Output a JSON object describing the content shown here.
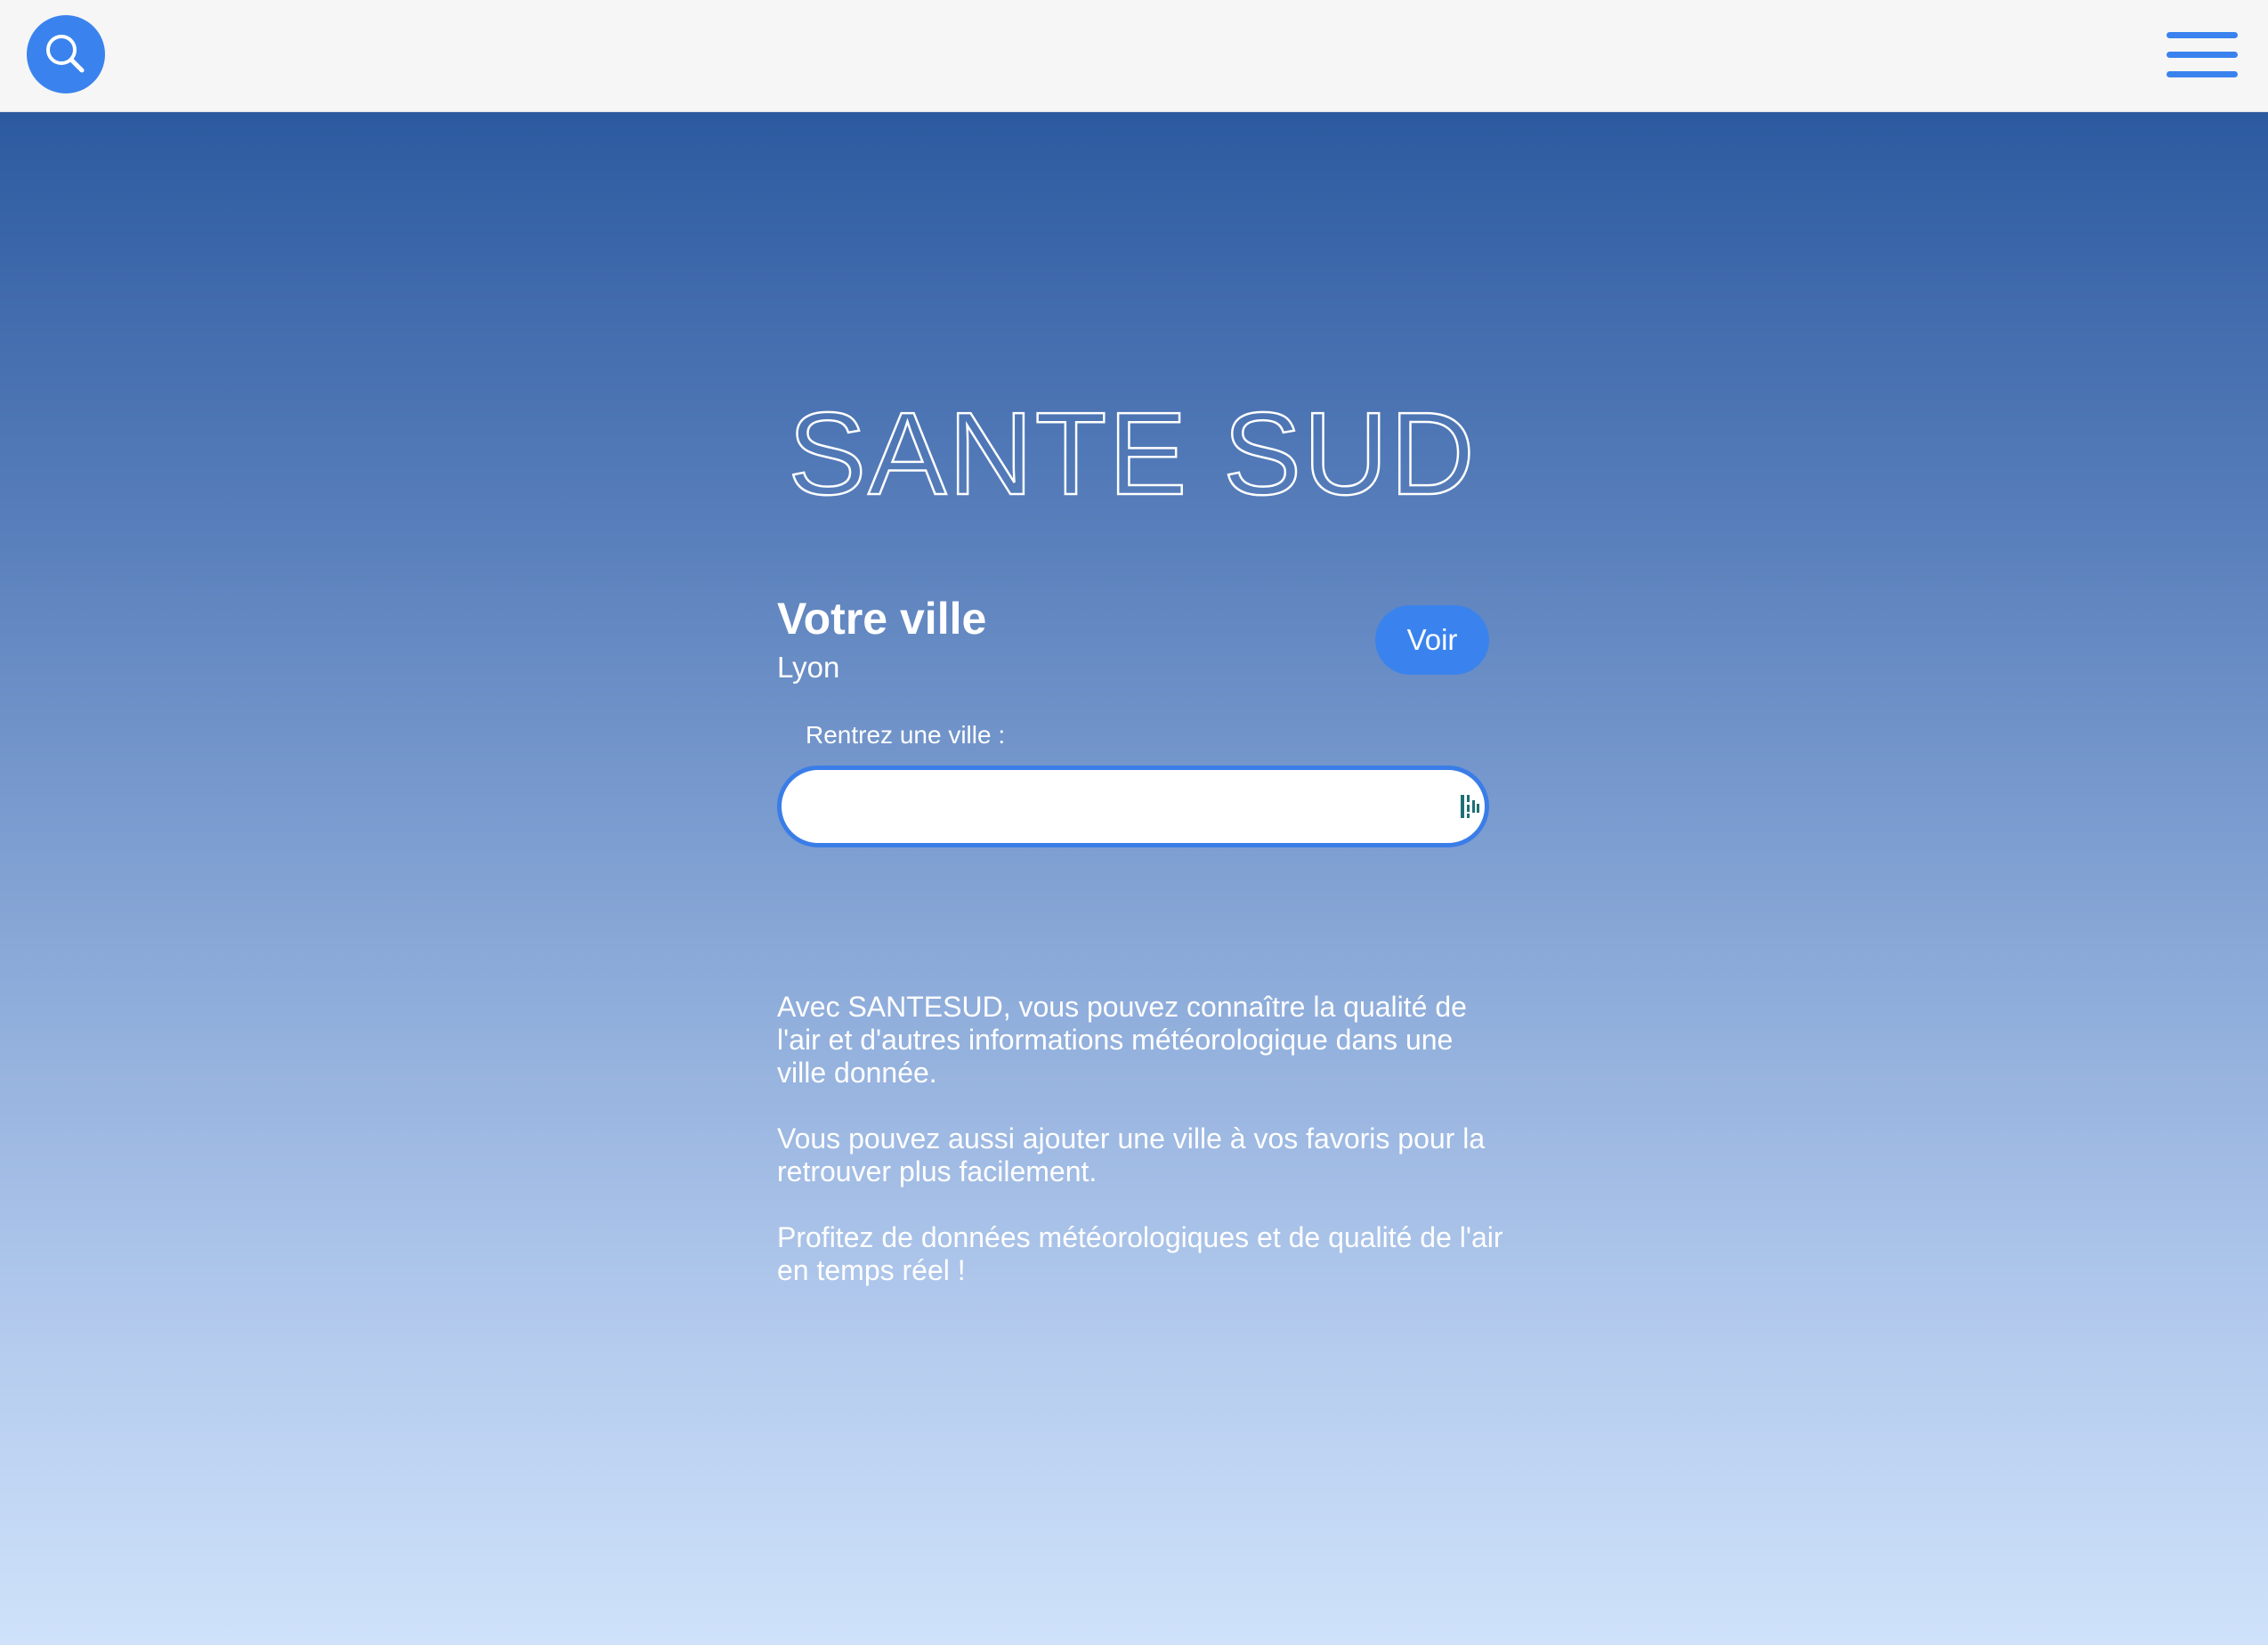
{
  "header": {
    "search_icon": "search-icon",
    "menu_icon": "hamburger-menu-icon"
  },
  "brand": {
    "title": "SANTE SUD"
  },
  "city_card": {
    "title": "Votre ville",
    "city": "Lyon",
    "button_label": "Voir"
  },
  "search": {
    "label": "Rentrez une ville :",
    "value": "",
    "placeholder": ""
  },
  "description": {
    "paragraph_1": "Avec SANTESUD, vous pouvez connaître la qualité de l'air et d'autres informations météorologique dans une ville donnée.",
    "paragraph_2": "Vous pouvez aussi ajouter une ville à vos favoris pour la retrouver plus facilement.",
    "paragraph_3": "Profitez de données météorologiques et de qualité de l'air en temps réel !"
  },
  "colors": {
    "accent": "#3a83ee",
    "topbar": "#f6f6f6",
    "gradient_top": "#2c5aa0",
    "gradient_bottom": "#cfe2fa"
  }
}
